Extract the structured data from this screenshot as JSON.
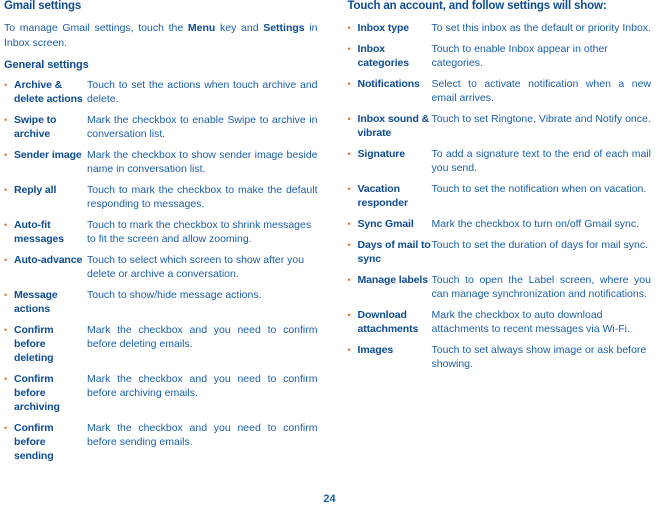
{
  "left": {
    "heading": "Gmail settings",
    "intro": {
      "part1": "To manage Gmail settings, touch the ",
      "bold1": "Menu",
      "part2": " key and ",
      "bold2": "Settings",
      "part3": " in Inbox screen."
    },
    "subheading": "General settings",
    "items": [
      {
        "term": "Archive & delete actions",
        "desc": "Touch to set the actions when touch archive and delete."
      },
      {
        "term": "Swipe to archive",
        "desc": "Mark the checkbox to enable Swipe to archive in conversation list."
      },
      {
        "term": "Sender image",
        "desc": "Mark the checkbox to show sender image beside name in conversation list."
      },
      {
        "term": "Reply all",
        "desc": "Touch to mark the checkbox to make the default responding to messages."
      },
      {
        "term": "Auto-fit messages",
        "desc": "Touch to mark the checkbox to shrink messages to fit the screen and allow zooming."
      },
      {
        "term": "Auto-advance",
        "desc": "Touch to select which screen to show after you delete or archive a conversation."
      },
      {
        "term": "Message actions",
        "desc": "Touch to show/hide message actions."
      },
      {
        "term": "Confirm before deleting",
        "desc": "Mark the checkbox and you need to confirm before deleting emails."
      },
      {
        "term": "Confirm before archiving",
        "desc": "Mark the checkbox and you need to confirm before archiving emails."
      },
      {
        "term": "Confirm before sending",
        "desc": "Mark the checkbox and you need to confirm before sending emails."
      }
    ]
  },
  "right": {
    "heading": "Touch an account, and follow settings will show:",
    "items": [
      {
        "term": "Inbox type",
        "desc": "To set this inbox as the default or priority Inbox."
      },
      {
        "term": "Inbox categories",
        "desc": "Touch to enable Inbox appear in other categories."
      },
      {
        "term": "Notifications",
        "desc": "Select to activate notification when a new email arrives."
      },
      {
        "term": "Inbox sound & vibrate",
        "desc": "Touch to set Ringtone, Vibrate and Notify once."
      },
      {
        "term": "Signature",
        "desc": "To add a signature text to the end of each mail you send."
      },
      {
        "term": "Vacation responder",
        "desc": "Touch to set the notification when on vacation."
      },
      {
        "term": "Sync Gmail",
        "desc": "Mark the checkbox to turn on/off Gmail sync."
      },
      {
        "term": "Days of mail to sync",
        "desc": "Touch to set the duration of days for mail sync."
      },
      {
        "term": "Manage labels",
        "desc": "Touch to open the Label screen, where you can manage synchronization and notifications."
      },
      {
        "term": "Download attachments",
        "desc": "Mark the checkbox to auto download attachments to recent messages via Wi-Fi."
      },
      {
        "term": "Images",
        "desc": "Touch to set always show image or ask before showing."
      }
    ]
  },
  "footer": {
    "page_number": "24"
  },
  "colors": {
    "body_text": "#1a5fa8",
    "heading_text": "#0e4c92",
    "bullet": "#e8722a",
    "background": "#ffffff"
  }
}
